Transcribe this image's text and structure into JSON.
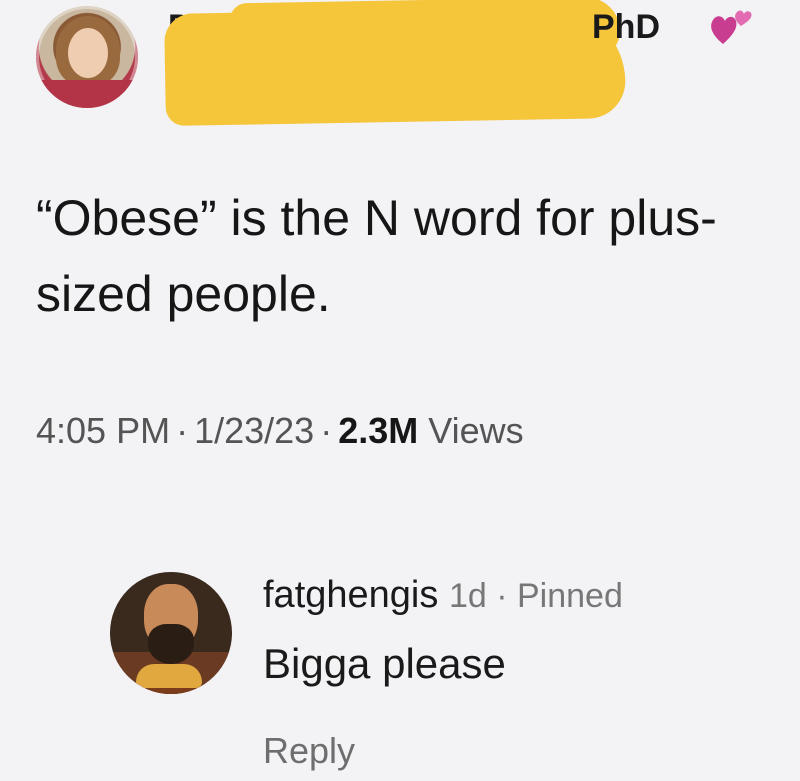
{
  "tweet": {
    "author_prefix": "Dr.",
    "author_suffix": "PhD",
    "text": "“Obese” is the N word for plus-sized people.",
    "time": "4:05 PM",
    "date": "1/23/23",
    "views_count": "2.3M",
    "views_label": "Views",
    "heart_icon": "two-hearts-icon",
    "heart_color": "#d8479c"
  },
  "comment": {
    "username": "fatghengis",
    "age": "1d",
    "pinned_label": "Pinned",
    "text": "Bigga please",
    "reply_label": "Reply"
  },
  "colors": {
    "background": "#f3f2f5",
    "redaction": "#f5c53a"
  }
}
